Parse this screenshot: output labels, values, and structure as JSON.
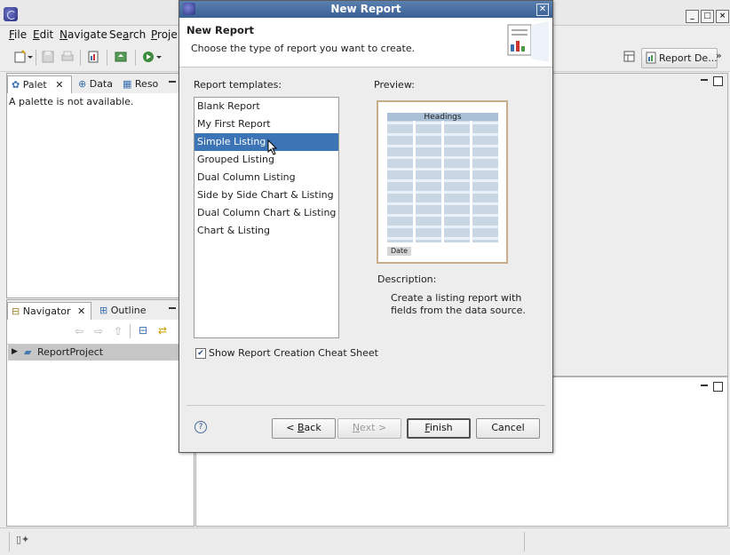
{
  "menu": [
    {
      "pre": "",
      "acc": "F",
      "post": "ile"
    },
    {
      "pre": "",
      "acc": "E",
      "post": "dit"
    },
    {
      "pre": "",
      "acc": "N",
      "post": "avigate"
    },
    {
      "pre": "Se",
      "acc": "a",
      "post": "rch"
    },
    {
      "pre": "",
      "acc": "P",
      "post": "roje"
    }
  ],
  "perspective": {
    "label": "Report De..."
  },
  "top_panel": {
    "tabs": [
      "Palet",
      "Data",
      "Reso"
    ],
    "message": "A palette is not available."
  },
  "bottom_panel": {
    "tabs": [
      "Navigator",
      "Outline"
    ],
    "tree": [
      "ReportProject"
    ]
  },
  "dialog": {
    "title": "New Report",
    "header_title": "New Report",
    "header_subtitle": "Choose the type of report you want to create.",
    "templates_label": "Report templates:",
    "templates": [
      "Blank Report",
      "My First Report",
      "Simple Listing",
      "Grouped Listing",
      "Dual Column Listing",
      "Side by Side Chart & Listing",
      "Dual Column Chart & Listing",
      "Chart & Listing"
    ],
    "selected_index": 2,
    "preview_label": "Preview:",
    "preview_heading": "Headings",
    "preview_footer": "Date",
    "description_label": "Description:",
    "description_line1": "Create a listing report with",
    "description_line2": "fields from the data source.",
    "cheat_sheet_label": "Show Report Creation Cheat Sheet",
    "cheat_sheet_checked": true,
    "buttons": {
      "back": {
        "pre": "< ",
        "acc": "B",
        "post": "ack"
      },
      "next": {
        "pre": "",
        "acc": "N",
        "post": "ext >"
      },
      "finish": {
        "pre": "",
        "acc": "F",
        "post": "inish"
      },
      "cancel": "Cancel"
    }
  }
}
